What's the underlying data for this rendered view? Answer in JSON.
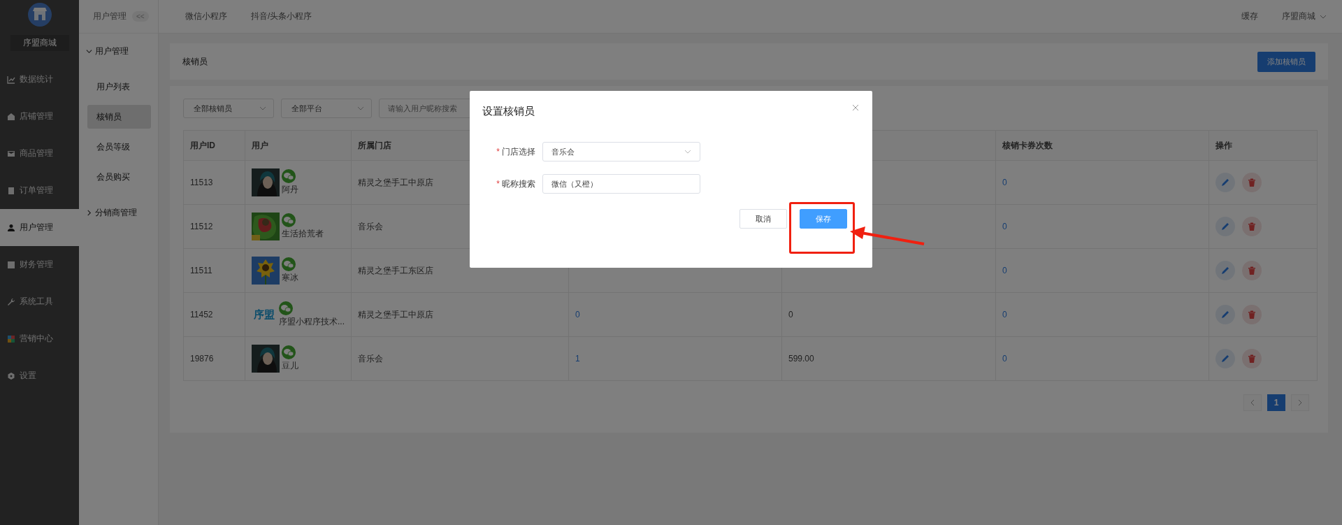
{
  "sidebar": {
    "brand": "序盟商城",
    "items": [
      {
        "label": "数据统计",
        "selected": false
      },
      {
        "label": "店铺管理",
        "selected": false
      },
      {
        "label": "商品管理",
        "selected": false
      },
      {
        "label": "订单管理",
        "selected": false
      },
      {
        "label": "用户管理",
        "selected": true
      },
      {
        "label": "财务管理",
        "selected": false
      },
      {
        "label": "系统工具",
        "selected": false
      },
      {
        "label": "营销中心",
        "selected": false
      },
      {
        "label": "设置",
        "selected": false
      }
    ]
  },
  "subnav": {
    "title": "用户管理",
    "collapse": "<<",
    "groups": [
      {
        "label": "用户管理",
        "expanded": true,
        "children": [
          {
            "label": "用户列表",
            "selected": false
          },
          {
            "label": "核销员",
            "selected": true
          },
          {
            "label": "会员等级",
            "selected": false
          },
          {
            "label": "会员购买",
            "selected": false
          }
        ]
      },
      {
        "label": "分销商管理",
        "expanded": false
      }
    ]
  },
  "topbar": {
    "tabs": [
      "微信小程序",
      "抖音/头条小程序"
    ],
    "cache": "缓存",
    "account": "序盟商城"
  },
  "page": {
    "title": "核销员",
    "add_button": "添加核销员"
  },
  "filters": {
    "selects": [
      "全部核销员",
      "全部平台"
    ],
    "search": {
      "placeholder": "请输入用户昵称搜索"
    }
  },
  "table": {
    "columns": {
      "user_id": "用户ID",
      "user": "用户",
      "store": "所属门店",
      "redeem_count": "核销卡券次数",
      "actions": "操作"
    },
    "rows": [
      {
        "id": "11513",
        "name": "阿丹",
        "store": "精灵之堡手工中原店",
        "redeem_count": "0"
      },
      {
        "id": "11512",
        "name": "生活拾荒者",
        "store": "音乐会",
        "redeem_count": "0"
      },
      {
        "id": "11511",
        "name": "寒冰",
        "store": "精灵之堡手工东区店",
        "redeem_count": "0"
      },
      {
        "id": "11452",
        "avatar": {
          "kind": "text",
          "text": "序盟"
        },
        "name": "序盟小程序技术...",
        "store": "精灵之堡手工中原店",
        "column_4": "0",
        "column_5": "0",
        "redeem_count": "0"
      },
      {
        "id": "19876",
        "name": "豆儿",
        "store": "音乐会",
        "column_4": "1",
        "column_5": "599.00",
        "redeem_count": "0"
      }
    ]
  },
  "pagination": {
    "pages": [
      {
        "label": "1",
        "selected": true
      }
    ]
  },
  "dialog": {
    "title": "设置核销员",
    "fields": [
      {
        "label": "门店选择",
        "required_mark": "*",
        "kind": "select",
        "value": "音乐会"
      },
      {
        "label": "昵称搜索",
        "required_mark": "*",
        "kind": "text",
        "value": "微信（又橙）"
      }
    ],
    "buttons": [
      {
        "label": "取消",
        "primary": false
      },
      {
        "label": "保存",
        "primary": true
      }
    ]
  }
}
